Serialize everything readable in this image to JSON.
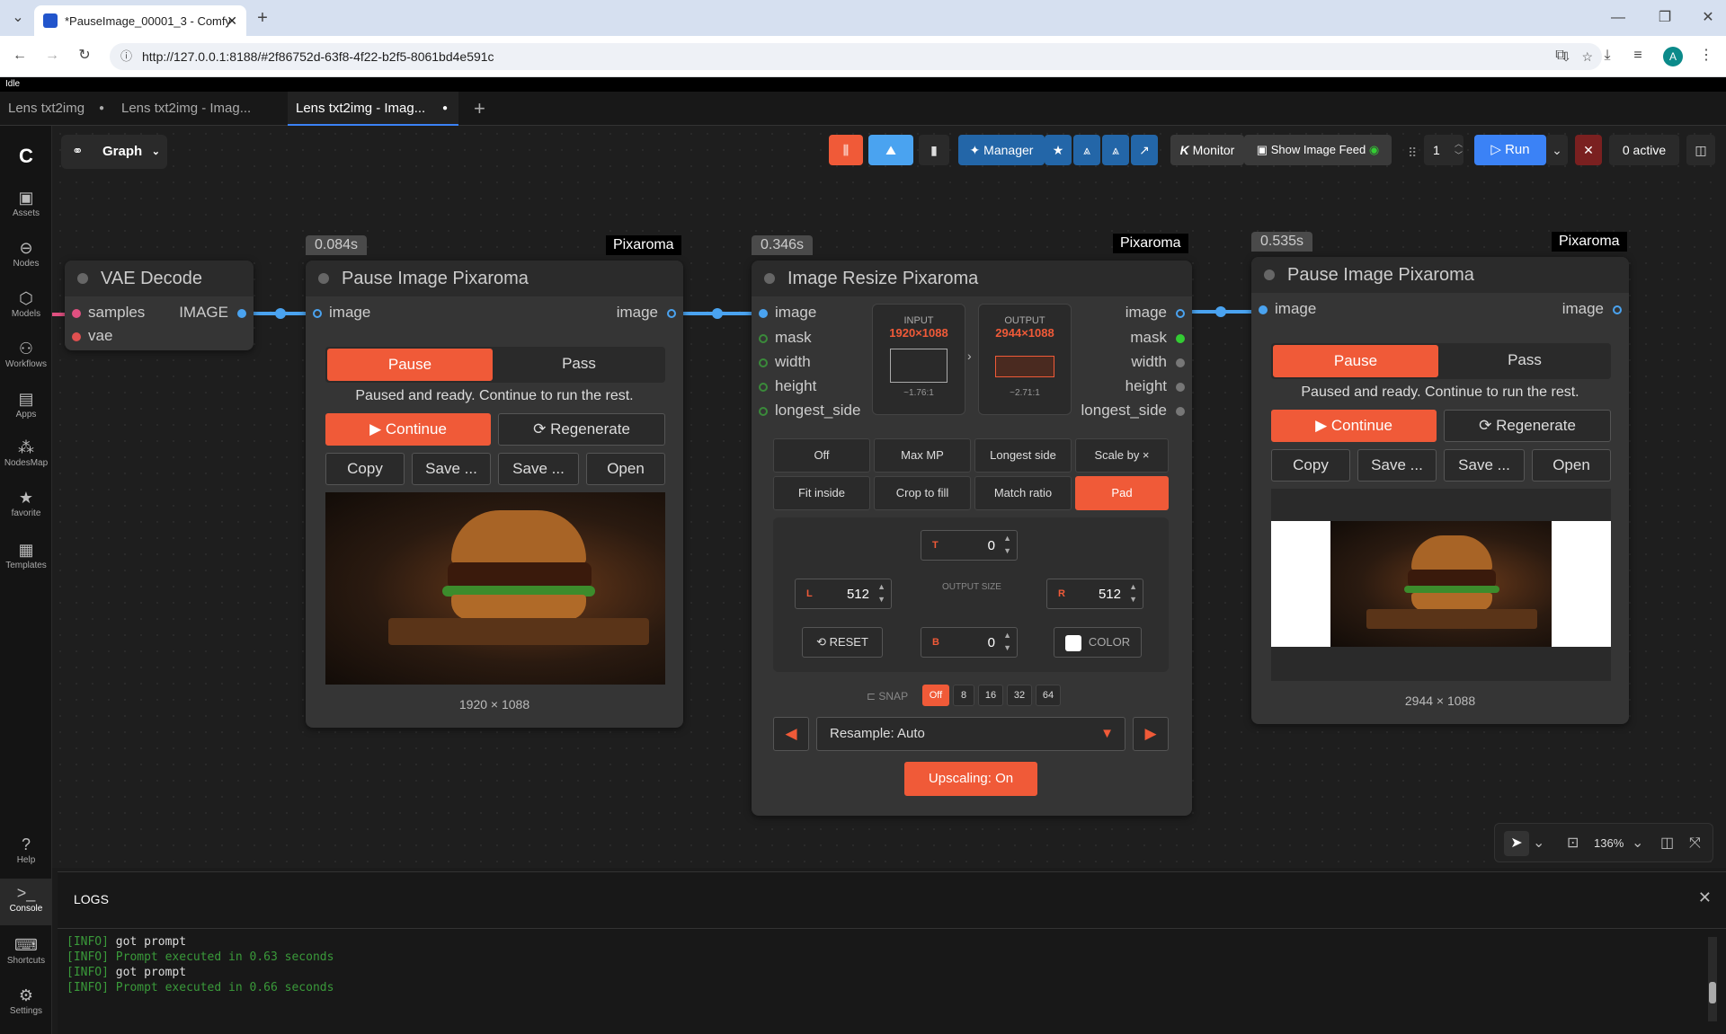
{
  "browser": {
    "tab_title": "*PauseImage_00001_3 - Comfy",
    "url": "http://127.0.0.1:8188/#2f86752d-63f8-4f22-b2f5-8061bd4e591c",
    "new_tab": "+",
    "profile_initial": "A"
  },
  "app": {
    "status": "Idle",
    "tabs": [
      {
        "label": "Lens txt2img"
      },
      {
        "label": "Lens txt2img - Imag..."
      },
      {
        "label": "Lens txt2img - Imag..."
      }
    ],
    "add_tab": "+",
    "graph_label": "Graph"
  },
  "sidebar": [
    {
      "label": "Assets",
      "icon": "image-icon"
    },
    {
      "label": "Nodes",
      "icon": "nodes-icon"
    },
    {
      "label": "Models",
      "icon": "cube-icon"
    },
    {
      "label": "Workflows",
      "icon": "workflow-icon"
    },
    {
      "label": "Apps",
      "icon": "apps-icon"
    },
    {
      "label": "NodesMap",
      "icon": "map-icon"
    },
    {
      "label": "favorite",
      "icon": "star-icon"
    },
    {
      "label": "Templates",
      "icon": "template-icon"
    },
    {
      "label": "Help",
      "icon": "help-icon"
    },
    {
      "label": "Console",
      "icon": "console-icon"
    },
    {
      "label": "Shortcuts",
      "icon": "keyboard-icon"
    },
    {
      "label": "Settings",
      "icon": "gear-icon"
    }
  ],
  "toolbar": {
    "manager": "Manager",
    "monitor": "Monitor",
    "show_feed": "Show Image Feed",
    "batch_count": "1",
    "run": "Run",
    "active": "0 active"
  },
  "nodes": {
    "vae": {
      "title": "VAE Decode",
      "inputs": [
        "samples",
        "vae"
      ],
      "output": "IMAGE"
    },
    "pause1": {
      "time": "0.084s",
      "brand": "Pixaroma",
      "title": "Pause Image Pixaroma",
      "input": "image",
      "output": "image",
      "pause": "Pause",
      "pass": "Pass",
      "status": "Paused and ready. Continue to run the rest.",
      "continue": "Continue",
      "regenerate": "Regenerate",
      "copy": "Copy",
      "save1": "Save ...",
      "save2": "Save ...",
      "open": "Open",
      "caption": "1920 × 1088"
    },
    "resize": {
      "time": "0.346s",
      "brand": "Pixaroma",
      "title": "Image Resize Pixaroma",
      "inputs": [
        "image",
        "mask",
        "width",
        "height",
        "longest_side"
      ],
      "outputs": [
        "image",
        "mask",
        "width",
        "height",
        "longest_side"
      ],
      "input_label": "INPUT",
      "input_size": "1920×1088",
      "input_ratio": "~1.76:1",
      "output_label": "OUTPUT",
      "output_size": "2944×1088",
      "output_ratio": "~2.71:1",
      "modes_row1": [
        "Off",
        "Max MP",
        "Longest side",
        "Scale by ×"
      ],
      "modes_row2": [
        "Fit inside",
        "Crop to fill",
        "Match ratio",
        "Pad"
      ],
      "pad_t_label": "T",
      "pad_t": "0",
      "pad_l_label": "L",
      "pad_l": "512",
      "pad_r_label": "R",
      "pad_r": "512",
      "pad_b_label": "B",
      "pad_b": "0",
      "output_size_label": "OUTPUT SIZE",
      "reset": "RESET",
      "color": "COLOR",
      "snap": "SNAP",
      "snap_options": [
        "Off",
        "8",
        "16",
        "32",
        "64"
      ],
      "resample": "Resample: Auto",
      "upscaling": "Upscaling: On"
    },
    "pause2": {
      "time": "0.535s",
      "brand": "Pixaroma",
      "title": "Pause Image Pixaroma",
      "input": "image",
      "output": "image",
      "pause": "Pause",
      "pass": "Pass",
      "status": "Paused and ready. Continue to run the rest.",
      "continue": "Continue",
      "regenerate": "Regenerate",
      "copy": "Copy",
      "save1": "Save ...",
      "save2": "Save ...",
      "open": "Open",
      "caption": "2944 × 1088"
    }
  },
  "zoom": "136%",
  "logs": {
    "title": "LOGS",
    "lines": [
      {
        "tag": "[INFO]",
        "text": "got prompt"
      },
      {
        "tag": "[INFO]",
        "text": "Prompt executed in 0.63 seconds"
      },
      {
        "tag": "[INFO]",
        "text": "got prompt"
      },
      {
        "tag": "[INFO]",
        "text": "Prompt executed in 0.66 seconds"
      }
    ]
  }
}
